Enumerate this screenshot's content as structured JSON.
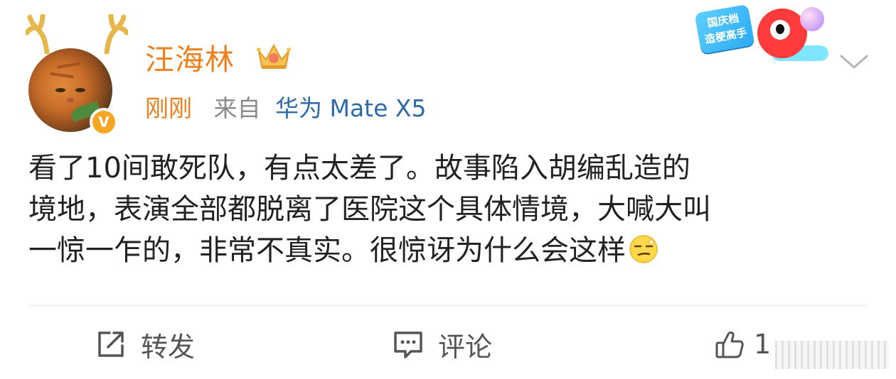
{
  "post": {
    "author": {
      "name": "汪海林",
      "verified_badge": "V"
    },
    "meta": {
      "time": "刚刚",
      "from_label": "来自",
      "device": "华为 Mate X5"
    },
    "sticker": {
      "line1": "国庆档",
      "line2": "造梗高手"
    },
    "content": {
      "line1": "看了10间敢死队，有点太差了。故事陷入胡编乱造的",
      "line2": "境地，表演全部都脱离了医院这个具体情境，大喊大叫",
      "line3": "一惊一乍的，非常不真实。很惊讶为什么会这样",
      "emoji": "smirk-emoji"
    },
    "actions": {
      "repost_label": "转发",
      "comment_label": "评论",
      "like_count": "1"
    }
  },
  "colors": {
    "username": "#ee7f1b",
    "time": "#ee7f1b",
    "device": "#2f6aa8",
    "meta_gray": "#8a8a8a",
    "text": "#222222",
    "action_gray": "#555555"
  }
}
